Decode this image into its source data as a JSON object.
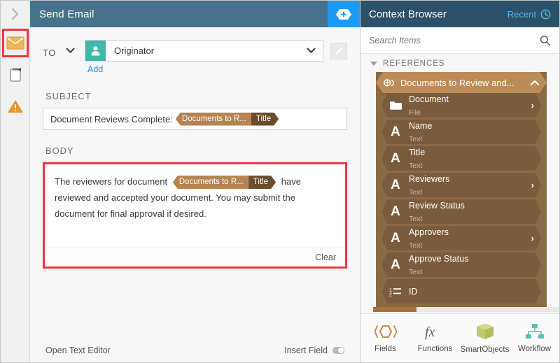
{
  "rail": {
    "collapse_icon": "chevron-right-icon",
    "items": [
      {
        "icon": "envelope-icon",
        "name": "email",
        "selected": true
      },
      {
        "icon": "clipboard-task-icon",
        "name": "task",
        "selected": false
      },
      {
        "icon": "warning-triangle-icon",
        "name": "warning",
        "selected": false
      }
    ]
  },
  "editor": {
    "title": "Send Email",
    "add_button_icon": "plus-hexagon-icon",
    "to": {
      "label": "TO",
      "caret_icon": "chevron-down-icon",
      "avatar_icon": "user-icon",
      "value": "Originator",
      "dropdown_icon": "chevron-down-icon",
      "add_link": "Add",
      "edit_icon": "pencil-icon"
    },
    "subject": {
      "label": "SUBJECT",
      "text": "Document Reviews Complete:",
      "token": {
        "source": "Documents to R...",
        "field": "Title"
      }
    },
    "body": {
      "label": "BODY",
      "text_before": "The reviewers for document",
      "token": {
        "source": "Documents to R...",
        "field": "Title"
      },
      "text_after": "have reviewed and accepted your document. You may submit the document for final approval if desired.",
      "clear_label": "Clear"
    },
    "footer": {
      "open_text_editor": "Open Text Editor",
      "insert_field": "Insert Field",
      "insert_field_toggle_icon": "toggle-off-icon"
    }
  },
  "context": {
    "title": "Context Browser",
    "recent_label": "Recent",
    "recent_icon": "clock-icon",
    "search": {
      "placeholder": "Search Items",
      "value": "",
      "icon": "search-icon"
    },
    "references_label": "REFERENCES",
    "references_toggle_icon": "triangle-down-icon",
    "group": {
      "label": "Documents to Review and...",
      "icon": "smartobject-icon",
      "collapse_icon": "chevron-up-icon"
    },
    "nodes": [
      {
        "icon": "folder-icon",
        "name": "Document",
        "type": "File",
        "arrow": "›"
      },
      {
        "icon": "text-a-icon",
        "name": "Name",
        "type": "Text",
        "arrow": ""
      },
      {
        "icon": "text-a-icon",
        "name": "Title",
        "type": "Text",
        "arrow": ""
      },
      {
        "icon": "text-a-icon",
        "name": "Reviewers",
        "type": "Text",
        "arrow": "›"
      },
      {
        "icon": "text-a-icon",
        "name": "Review Status",
        "type": "Text",
        "arrow": ""
      },
      {
        "icon": "text-a-icon",
        "name": "Approvers",
        "type": "Text",
        "arrow": "›"
      },
      {
        "icon": "text-a-icon",
        "name": "Approve Status",
        "type": "Text",
        "arrow": ""
      },
      {
        "icon": "number-list-icon",
        "name": "ID",
        "type": "",
        "arrow": ""
      }
    ],
    "tabs": [
      {
        "label": "Fields",
        "icon": "fields-hexagon-icon"
      },
      {
        "label": "Functions",
        "icon": "fx-icon"
      },
      {
        "label": "SmartObjects",
        "icon": "cube-icon"
      },
      {
        "label": "Workflow",
        "icon": "workflow-icon"
      }
    ]
  },
  "colors": {
    "header_blue": "#46738b",
    "context_header_blue": "#2b5268",
    "accent_blue": "#1b9af7",
    "highlight_red": "#f5333f",
    "token_source_brown": "#b58450",
    "token_field_brown": "#6d4c2b",
    "node_brown": "#7a5c3c",
    "group_brown": "#bb8c59",
    "avatar_teal": "#3fb8a8",
    "link_blue": "#2d8fe0"
  }
}
